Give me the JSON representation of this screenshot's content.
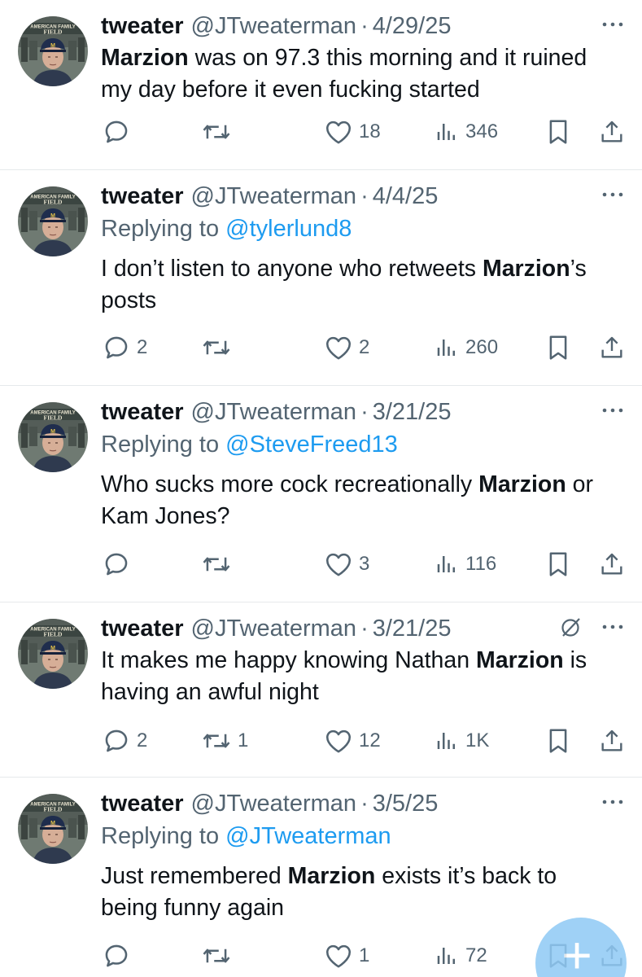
{
  "colors": {
    "text": "#0f1419",
    "secondary": "#536471",
    "link": "#1d9bf0",
    "divider": "#e6e9eb",
    "fab": "#8fcaf5"
  },
  "tweets": [
    {
      "name": "tweater",
      "handle": "@JTweaterman",
      "separator": "·",
      "date": "4/29/25",
      "reply_prefix": "",
      "reply_to": "",
      "parts": [
        {
          "b": true,
          "t": "Marzion"
        },
        {
          "b": false,
          "t": " was on 97.3 this morning and it ruined\nmy day before it even fucking started"
        }
      ],
      "replies": "",
      "retweets": "",
      "likes": "18",
      "views": "346",
      "show_grok": false
    },
    {
      "name": "tweater",
      "handle": "@JTweaterman",
      "separator": "·",
      "date": "4/4/25",
      "reply_prefix": "Replying to",
      "reply_to": "@tylerlund8",
      "parts": [
        {
          "b": false,
          "t": "I don’t listen to anyone who retweets "
        },
        {
          "b": true,
          "t": "Marzion"
        },
        {
          "b": false,
          "t": "’s\nposts"
        }
      ],
      "replies": "2",
      "retweets": "",
      "likes": "2",
      "views": "260",
      "show_grok": false
    },
    {
      "name": "tweater",
      "handle": "@JTweaterman",
      "separator": "·",
      "date": "3/21/25",
      "reply_prefix": "Replying to",
      "reply_to": "@SteveFreed13",
      "parts": [
        {
          "b": false,
          "t": "Who sucks more cock recreationally "
        },
        {
          "b": true,
          "t": "Marzion"
        },
        {
          "b": false,
          "t": " or\nKam Jones?"
        }
      ],
      "replies": "",
      "retweets": "",
      "likes": "3",
      "views": "116",
      "show_grok": false
    },
    {
      "name": "tweater",
      "handle": "@JTweaterman",
      "separator": "·",
      "date": "3/21/25",
      "reply_prefix": "",
      "reply_to": "",
      "parts": [
        {
          "b": false,
          "t": "It makes me happy knowing Nathan "
        },
        {
          "b": true,
          "t": "Marzion"
        },
        {
          "b": false,
          "t": " is\nhaving an awful night"
        }
      ],
      "replies": "2",
      "retweets": "1",
      "likes": "12",
      "views": "1K",
      "show_grok": true
    },
    {
      "name": "tweater",
      "handle": "@JTweaterman",
      "separator": "·",
      "date": "3/5/25",
      "reply_prefix": "Replying to",
      "reply_to": "@JTweaterman",
      "parts": [
        {
          "b": false,
          "t": "Just remembered "
        },
        {
          "b": true,
          "t": "Marzion"
        },
        {
          "b": false,
          "t": " exists it’s back to\nbeing funny again"
        }
      ],
      "replies": "",
      "retweets": "",
      "likes": "1",
      "views": "72",
      "show_grok": false
    }
  ],
  "avatar_text": {
    "line1": "AMERICAN FAMILY",
    "line2": "FIELD"
  },
  "icons": {
    "reply": "reply-icon",
    "retweet": "retweet-icon",
    "like": "heart-icon",
    "views": "views-chart-icon",
    "bookmark": "bookmark-icon",
    "share": "share-icon",
    "more": "more-dots-icon",
    "grok": "grok-icon",
    "compose": "plus-icon"
  },
  "fab": {
    "symbol": "+"
  }
}
